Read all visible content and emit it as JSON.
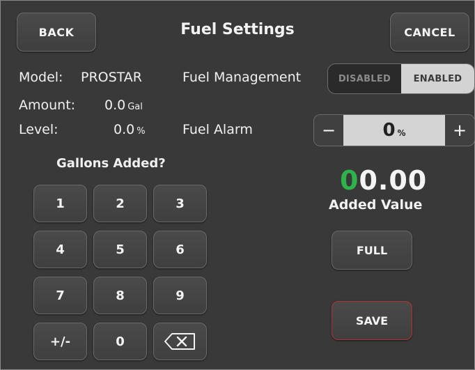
{
  "header": {
    "title": "Fuel Settings",
    "back_label": "BACK",
    "cancel_label": "CANCEL"
  },
  "info": {
    "model_label": "Model:",
    "model_value": "PROSTAR",
    "amount_label": "Amount:",
    "amount_value": "0.0",
    "amount_unit": "Gal",
    "level_label": "Level:",
    "level_value": "0.0",
    "level_unit": "%"
  },
  "fuel_management": {
    "label": "Fuel Management",
    "options": [
      "DISABLED",
      "ENABLED"
    ],
    "selected": "ENABLED"
  },
  "fuel_alarm": {
    "label": "Fuel Alarm",
    "minus": "−",
    "plus": "+",
    "value": "0",
    "unit": "%"
  },
  "keypad": {
    "title": "Gallons Added?",
    "keys": [
      "1",
      "2",
      "3",
      "4",
      "5",
      "6",
      "7",
      "8",
      "9",
      "+/-",
      "0"
    ],
    "backspace_icon": "backspace-icon"
  },
  "added": {
    "value_green": "0",
    "value_rest": "0.00",
    "label": "Added Value",
    "full_label": "FULL",
    "save_label": "SAVE"
  },
  "colors": {
    "background": "#393939",
    "accent_green": "#2fb24a",
    "save_border": "#b03434"
  }
}
